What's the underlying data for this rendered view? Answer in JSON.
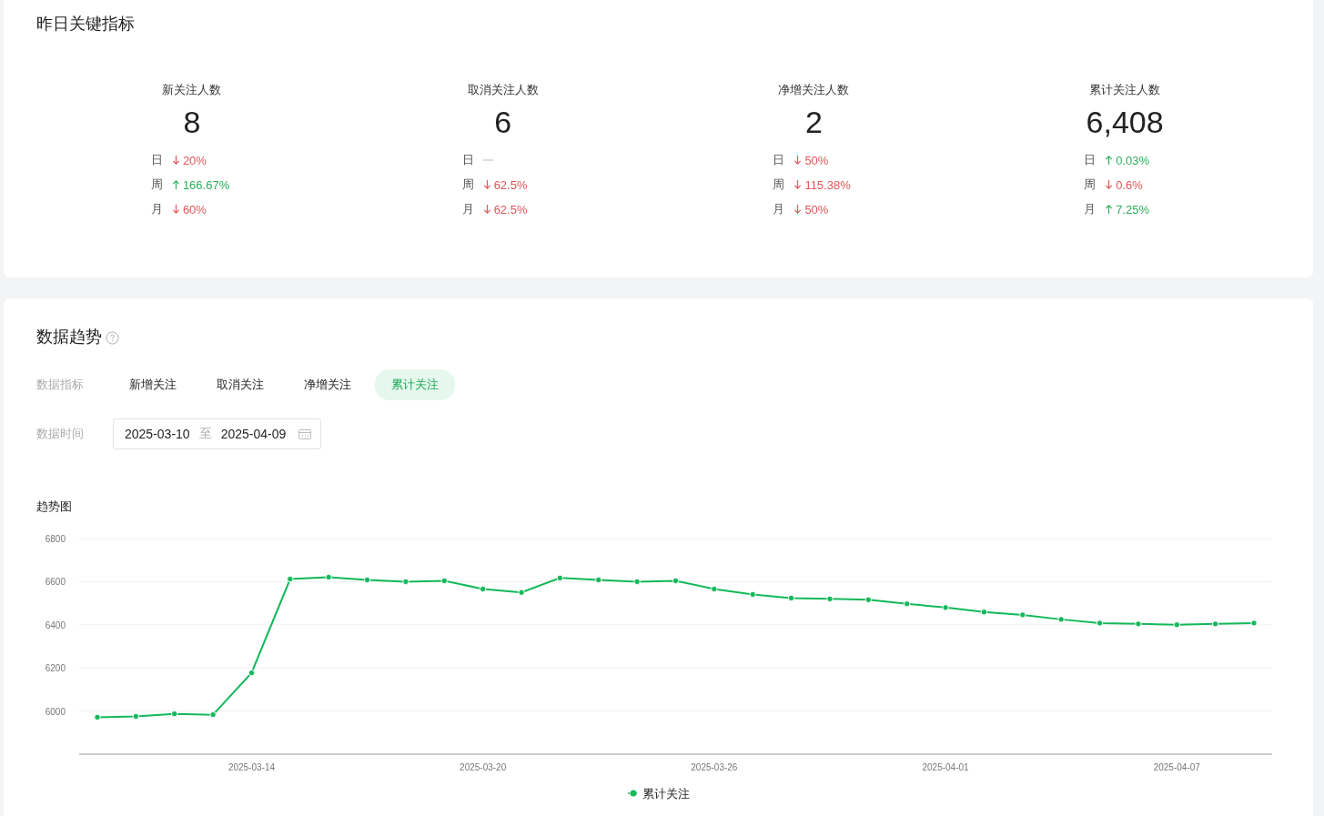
{
  "summary": {
    "title": "昨日关键指标",
    "metrics": [
      {
        "label": "新关注人数",
        "value": "8",
        "changes": [
          {
            "period": "日",
            "kind": "down",
            "text": "20%"
          },
          {
            "period": "周",
            "kind": "up",
            "text": "166.67%"
          },
          {
            "period": "月",
            "kind": "down",
            "text": "60%"
          }
        ]
      },
      {
        "label": "取消关注人数",
        "value": "6",
        "changes": [
          {
            "period": "日",
            "kind": "none"
          },
          {
            "period": "周",
            "kind": "down",
            "text": "62.5%"
          },
          {
            "period": "月",
            "kind": "down",
            "text": "62.5%"
          }
        ]
      },
      {
        "label": "净增关注人数",
        "value": "2",
        "changes": [
          {
            "period": "日",
            "kind": "down",
            "text": "50%"
          },
          {
            "period": "周",
            "kind": "down",
            "text": "115.38%"
          },
          {
            "period": "月",
            "kind": "down",
            "text": "50%"
          }
        ]
      },
      {
        "label": "累计关注人数",
        "value": "6,408",
        "changes": [
          {
            "period": "日",
            "kind": "up",
            "text": "0.03%"
          },
          {
            "period": "周",
            "kind": "down",
            "text": "0.6%"
          },
          {
            "period": "月",
            "kind": "up",
            "text": "7.25%"
          }
        ]
      }
    ]
  },
  "trend": {
    "title": "数据趋势",
    "metric_filter": {
      "label": "数据指标",
      "options": [
        {
          "label": "新增关注",
          "selected": false
        },
        {
          "label": "取消关注",
          "selected": false
        },
        {
          "label": "净增关注",
          "selected": false
        },
        {
          "label": "累计关注",
          "selected": true
        }
      ]
    },
    "date_filter": {
      "label": "数据时间",
      "start": "2025-03-10",
      "separator": "至",
      "end": "2025-04-09"
    },
    "chart_data": {
      "type": "line",
      "title": "趋势图",
      "categories": [
        null,
        null,
        null,
        null,
        "2025-03-14",
        null,
        null,
        null,
        null,
        null,
        "2025-03-20",
        null,
        null,
        null,
        null,
        null,
        "2025-03-26",
        null,
        null,
        null,
        null,
        null,
        "2025-04-01",
        null,
        null,
        null,
        null,
        null,
        "2025-04-07",
        null,
        null
      ],
      "grid": true,
      "series": [
        {
          "name": "累计关注",
          "color": "#13b85a",
          "marker": "circle",
          "values": [
            5971,
            5975,
            5987,
            5983,
            6177,
            6612,
            6621,
            6608,
            6600,
            6604,
            6566,
            6550,
            6617,
            6608,
            6600,
            6604,
            6566,
            6541,
            6524,
            6520,
            6516,
            6497,
            6480,
            6459,
            6446,
            6425,
            6408,
            6404,
            6400,
            6404,
            6408
          ]
        }
      ],
      "ylim": [
        5800,
        6800
      ],
      "yticks": [
        6000,
        6200,
        6400,
        6600,
        6800
      ]
    }
  }
}
